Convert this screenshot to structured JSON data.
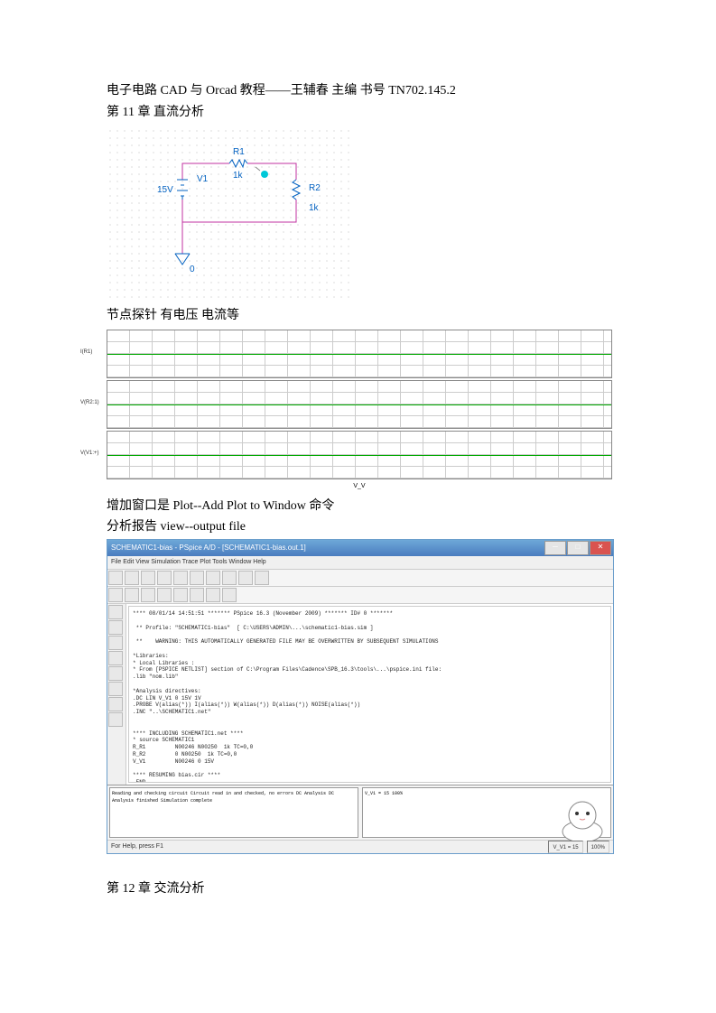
{
  "header": {
    "title": "电子电路 CAD 与 Orcad 教程——王辅春 主编 书号 TN702.145.2"
  },
  "chapter11": {
    "title": "第 11 章 直流分析",
    "circuit": {
      "r1": {
        "name": "R1",
        "value": "1k"
      },
      "r2": {
        "name": "R2",
        "value": "1k"
      },
      "v1": {
        "name": "V1",
        "voltage": "15V"
      },
      "gnd": "0"
    },
    "probe_text": "节点探针 有电压 电流等",
    "plot_command": "增加窗口是 Plot--Add Plot to Window 命令",
    "report_command": "分析报告 view--output file"
  },
  "chart_data": {
    "type": "line",
    "panes": 3,
    "title": "",
    "xlabel": "V_V",
    "xlim": [
      0,
      15
    ],
    "series": [
      {
        "name": "I(R1)",
        "ylabel": "",
        "values": "ramp"
      },
      {
        "name": "V(R2:1)",
        "ylabel": "",
        "values": "flat"
      },
      {
        "name": "V(V1:+)",
        "ylabel": "",
        "values": "ramp"
      }
    ]
  },
  "pspice": {
    "window_title": "SCHEMATIC1-bias - PSpice A/D - [SCHEMATIC1-bias.out.1]",
    "menu": "File  Edit  View  Simulation  Trace  Plot  Tools  Window  Help",
    "output_lines": [
      "**** 08/01/14 14:51:51 ******* PSpice 16.3 (November 2009) ******* ID# 0 *******",
      "",
      " ** Profile: \"SCHEMATIC1-bias\"  [ C:\\USERS\\ADMIN\\...\\schematic1-bias.sim ]",
      "",
      " **    WARNING: THIS AUTOMATICALLY GENERATED FILE MAY BE OVERWRITTEN BY SUBSEQUENT SIMULATIONS",
      "",
      "*Libraries:",
      "* Local Libraries :",
      "* From [PSPICE NETLIST] section of C:\\Program Files\\Cadence\\SPB_16.3\\tools\\...\\pspice.ini file:",
      ".lib \"nom.lib\"",
      "",
      "*Analysis directives:",
      ".DC LIN V_V1 0 15V 1V",
      ".PROBE V(alias(*)) I(alias(*)) W(alias(*)) D(alias(*)) NOISE(alias(*))",
      ".INC \"..\\SCHEMATIC1.net\"",
      "",
      "",
      "**** INCLUDING SCHEMATIC1.net ****",
      "* source SCHEMATIC1",
      "R_R1         N00246 N00250  1k TC=0,0",
      "R_R2         0 N00250  1k TC=0,0",
      "V_V1         N00246 0 15V",
      "",
      "**** RESUMING bias.cir ****",
      ".END"
    ],
    "bottom_left": "Reading and checking circuit\nCircuit read in and checked, no errors\nDC Analysis\nDC Analysis finished\nSimulation complete",
    "bottom_right": "V_V1 = 15\n\n100%",
    "status_left": "For Help, press F1",
    "status_right": [
      "V_V1 = 15",
      "100%"
    ]
  },
  "chapter12": {
    "title": "第 12 章 交流分析"
  }
}
